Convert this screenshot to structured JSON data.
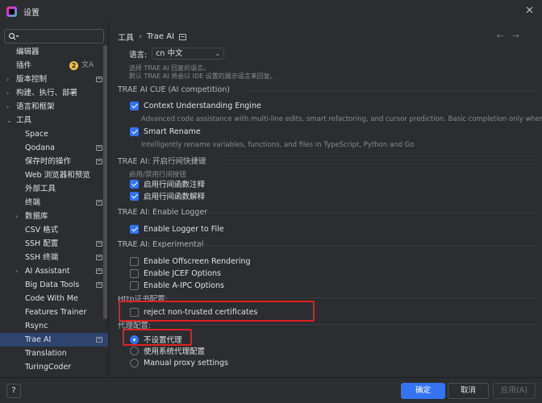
{
  "window": {
    "title": "设置",
    "close": "✕"
  },
  "search": {
    "icon": "search-icon"
  },
  "sidebar": {
    "items": [
      {
        "label": "编辑器",
        "level": 0,
        "chevron": ""
      },
      {
        "label": "插件",
        "level": 0,
        "chevron": "",
        "badge": "2"
      },
      {
        "label": "版本控制",
        "level": 0,
        "chevron": "›"
      },
      {
        "label": "构建、执行、部署",
        "level": 0,
        "chevron": "›"
      },
      {
        "label": "语言和框架",
        "level": 0,
        "chevron": "›"
      },
      {
        "label": "工具",
        "level": 0,
        "chevron": "⌄"
      },
      {
        "label": "Space",
        "level": 1,
        "chevron": ""
      },
      {
        "label": "Qodana",
        "level": 1,
        "chevron": ""
      },
      {
        "label": "保存时的操作",
        "level": 1,
        "chevron": ""
      },
      {
        "label": "Web 浏览器和预览",
        "level": 1,
        "chevron": ""
      },
      {
        "label": "外部工具",
        "level": 1,
        "chevron": ""
      },
      {
        "label": "终端",
        "level": 1,
        "chevron": ""
      },
      {
        "label": "数据库",
        "level": 1,
        "chevron": "›"
      },
      {
        "label": "CSV 格式",
        "level": 1,
        "chevron": ""
      },
      {
        "label": "SSH 配置",
        "level": 1,
        "chevron": ""
      },
      {
        "label": "SSH 终端",
        "level": 1,
        "chevron": ""
      },
      {
        "label": "AI Assistant",
        "level": 1,
        "chevron": "›"
      },
      {
        "label": "Big Data Tools",
        "level": 1,
        "chevron": ""
      },
      {
        "label": "Code With Me",
        "level": 1,
        "chevron": ""
      },
      {
        "label": "Features Trainer",
        "level": 1,
        "chevron": ""
      },
      {
        "label": "Rsync",
        "level": 1,
        "chevron": ""
      },
      {
        "label": "Trae AI",
        "level": 1,
        "chevron": ""
      },
      {
        "label": "Translation",
        "level": 1,
        "chevron": ""
      },
      {
        "label": "TuringCoder",
        "level": 1,
        "chevron": ""
      }
    ]
  },
  "breadcrumb": {
    "parent": "工具",
    "sep": "›",
    "current": "Trae AI",
    "back": "←",
    "forward": "→"
  },
  "language": {
    "label": "语言:",
    "value": "cn 中文",
    "hint1": "选择 TRAE AI 回复的语言。",
    "hint2": "默认 TRAE AI 将会以 IDE 设置的展示语言来回复。"
  },
  "cue": {
    "title": "TRAE AI CUE (AI competition)",
    "context_label": "Context Understanding Engine",
    "context_desc": "Advanced code assistance with multi-line edits, smart refactoring, and cursor prediction. Basic completion only when off.",
    "rename_label": "Smart Rename",
    "rename_desc": "Intelligently rename variables, functions, and files in TypeScript, Python and Go"
  },
  "shortcuts": {
    "title": "TRAE AI: 开启行间快捷键",
    "sub": "启用/禁用行间按钮",
    "opt1": "启用行间函数注释",
    "opt2": "启用行间函数解释"
  },
  "logger": {
    "title": "TRAE AI: Enable Logger",
    "opt": "Enable Logger to File"
  },
  "experimental": {
    "title": "TRAE AI: Experimental",
    "opt1": "Enable Offscreen Rendering",
    "opt2": "Enable JCEF Options",
    "opt3": "Enable A-IPC Options"
  },
  "http": {
    "title": "Http证书配置:",
    "opt": "reject non-trusted certificates"
  },
  "proxy": {
    "title": "代理配置:",
    "opt1": "不设置代理",
    "opt2": "使用系统代理配置",
    "opt3": "Manual proxy settings"
  },
  "footer": {
    "help": "?",
    "ok": "确定",
    "cancel": "取消",
    "apply": "应用(A)"
  },
  "colors": {
    "accent": "#3574f0",
    "highlight": "#e02020",
    "selected": "#2e436e",
    "badge": "#f0c24a"
  }
}
